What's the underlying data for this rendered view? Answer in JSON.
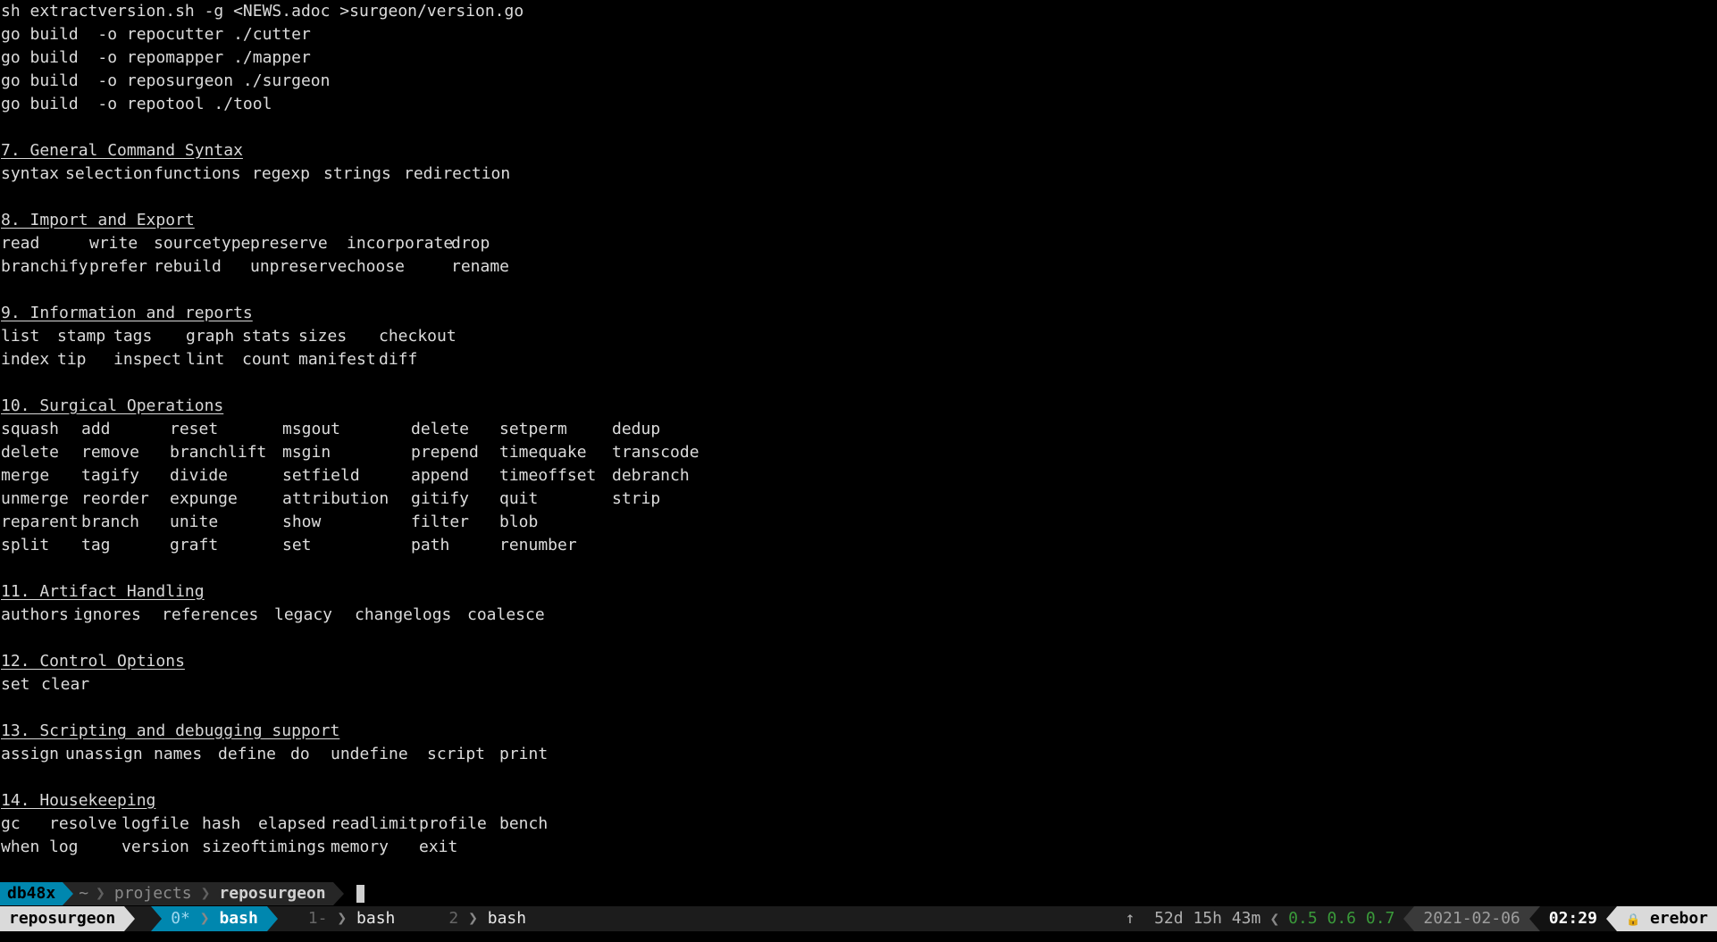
{
  "terminal": {
    "build_lines": [
      "sh extractversion.sh -g <NEWS.adoc >surgeon/version.go",
      "go build  -o repocutter ./cutter",
      "go build  -o repomapper ./mapper",
      "go build  -o reposurgeon ./surgeon",
      "go build  -o repotool ./tool"
    ],
    "sections": [
      {
        "title": "7. General Command Syntax",
        "rows": [
          [
            "syntax",
            "selection",
            "functions",
            "regexp",
            "strings",
            "redirection"
          ]
        ],
        "cols": "72px 99px 110px 80px 90px 130px"
      },
      {
        "title": "8. Import and Export",
        "rows": [
          [
            "read",
            "write",
            "sourcetype",
            "preserve",
            "incorporate",
            "drop"
          ],
          [
            "branchify",
            "prefer",
            "rebuild",
            "unpreserve",
            "choose",
            "rename"
          ]
        ],
        "cols": "99px 72px 108px 108px 117px 80px"
      },
      {
        "title": "9. Information and reports",
        "rows": [
          [
            "list",
            "stamp",
            "tags",
            "graph",
            "stats",
            "sizes",
            "checkout"
          ],
          [
            "index",
            "tip",
            "inspect",
            "lint",
            "count",
            "manifest",
            "diff"
          ]
        ],
        "cols": "63px 63px 81px 63px 63px 90px 90px"
      },
      {
        "title": "10. Surgical Operations",
        "rows": [
          [
            "squash",
            "add",
            "reset",
            "msgout",
            "delete",
            "setperm",
            "dedup"
          ],
          [
            "delete",
            "remove",
            "branchlift",
            "msgin",
            "prepend",
            "timequake",
            "transcode"
          ],
          [
            "merge",
            "tagify",
            "divide",
            "setfield",
            "append",
            "timeoffset",
            "debranch"
          ],
          [
            "unmerge",
            "reorder",
            "expunge",
            "attribution",
            "gitify",
            "quit",
            "strip"
          ],
          [
            "reparent",
            "branch",
            "unite",
            "show",
            "filter",
            "blob",
            ""
          ],
          [
            "split",
            "tag",
            "graft",
            "set",
            "path",
            "renumber",
            ""
          ]
        ],
        "cols": "90px 99px 126px 144px 99px 126px 110px"
      },
      {
        "title": "11. Artifact Handling",
        "rows": [
          [
            "authors",
            "ignores",
            "references",
            "legacy",
            "changelogs",
            "coalesce"
          ]
        ],
        "cols": "81px 99px 126px 90px 126px 90px"
      },
      {
        "title": "12. Control Options",
        "rows": [
          [
            "set",
            "clear"
          ]
        ],
        "cols": "45px 60px"
      },
      {
        "title": "13. Scripting and debugging support",
        "rows": [
          [
            "assign",
            "unassign",
            "names",
            "define",
            "do",
            "undefine",
            "script",
            "print"
          ]
        ],
        "cols": "72px 99px 72px 81px 45px 108px 81px 60px"
      },
      {
        "title": "14. Housekeeping",
        "rows": [
          [
            "gc",
            "resolve",
            "logfile",
            "hash",
            "elapsed",
            "readlimit",
            "profile",
            "bench"
          ],
          [
            "when",
            "log",
            "version",
            "sizeof",
            "timings",
            "memory",
            "exit",
            ""
          ]
        ],
        "cols": "54px 81px 90px 63px 81px 99px 90px 70px"
      }
    ]
  },
  "prompt": {
    "host": "db48x",
    "home": "~",
    "path": [
      "projects",
      "reposurgeon"
    ]
  },
  "statusbar": {
    "session": "reposurgeon",
    "windows": [
      {
        "index": "0*",
        "name": "bash",
        "active": true
      },
      {
        "index": "1-",
        "name": "bash",
        "active": false
      },
      {
        "index": "2",
        "name": "bash",
        "active": false
      }
    ],
    "uptime_arrow": "↑",
    "uptime": "52d 15h 43m",
    "load": "0.5 0.6 0.7",
    "date": "2021-02-06",
    "time": "02:29",
    "lock_glyph": "🔒",
    "hostname": "erebor"
  },
  "colors": {
    "accent": "#0087af",
    "session_bg": "#dadada",
    "load_text": "#3a9a3a"
  }
}
